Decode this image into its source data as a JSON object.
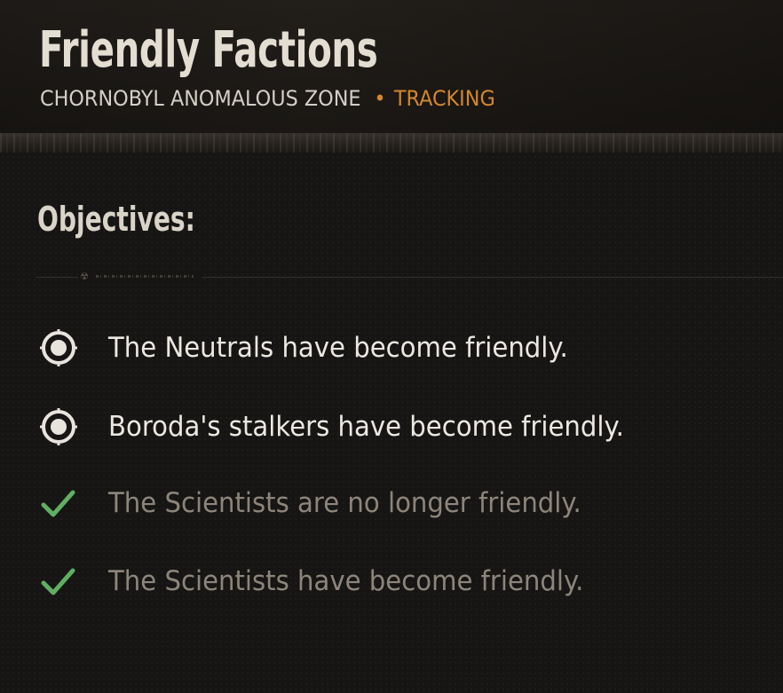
{
  "header": {
    "title": "Friendly Factions",
    "location": "CHORNOBYL ANOMALOUS ZONE",
    "separator": "•",
    "status": "TRACKING"
  },
  "objectives": {
    "heading": "Objectives:",
    "items": [
      {
        "text": "The Neutrals have become friendly.",
        "state": "active",
        "icon": "target-icon"
      },
      {
        "text": "Boroda's stalkers have become friendly.",
        "state": "active",
        "icon": "target-icon"
      },
      {
        "text": "The Scientists are no longer friendly.",
        "state": "completed",
        "icon": "checkmark-icon"
      },
      {
        "text": "The Scientists have become friendly.",
        "state": "completed",
        "icon": "checkmark-icon"
      }
    ]
  },
  "colors": {
    "background": "#161514",
    "title": "#e3ddd2",
    "accent": "#d4862e",
    "active_text": "#ece8e1",
    "completed_text": "#8d857a",
    "check_green": "#5fae63"
  }
}
